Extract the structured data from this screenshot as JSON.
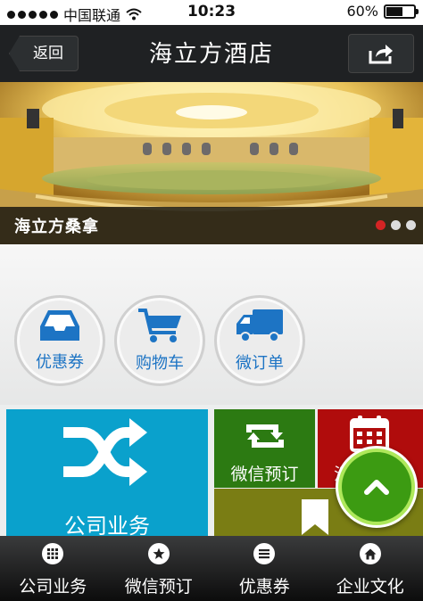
{
  "status_bar": {
    "carrier": "中国联通",
    "time": "10:23",
    "battery_text": "60%",
    "battery_level": 0.6
  },
  "header": {
    "back_label": "返回",
    "title": "海立方酒店",
    "share_icon": "share-icon"
  },
  "banner": {
    "caption": "海立方桑拿",
    "page_count": 3,
    "active_page": 1,
    "active_color": "#d42424"
  },
  "shortcuts": [
    {
      "label": "优惠券",
      "icon": "inbox-icon"
    },
    {
      "label": "购物车",
      "icon": "cart-icon"
    },
    {
      "label": "微订单",
      "icon": "truck-icon"
    }
  ],
  "tiles": {
    "company": {
      "label": "公司业务",
      "icon": "shuffle-icon",
      "color": "#0aa1cc"
    },
    "wechat_booking": {
      "label": "微信预订",
      "icon": "retweet-icon",
      "color": "#2c7a12"
    },
    "calendar": {
      "label": "活",
      "icon": "calendar-icon",
      "color": "#b00c0c"
    },
    "bookmark": {
      "icon": "bookmark-icon",
      "color": "#7a7d14"
    }
  },
  "scroll_top_icon": "chevron-up-icon",
  "tabbar": [
    {
      "label": "公司业务",
      "icon": "grid-icon"
    },
    {
      "label": "微信预订",
      "icon": "star-icon"
    },
    {
      "label": "优惠券",
      "icon": "list-icon"
    },
    {
      "label": "企业文化",
      "icon": "home-icon"
    }
  ]
}
